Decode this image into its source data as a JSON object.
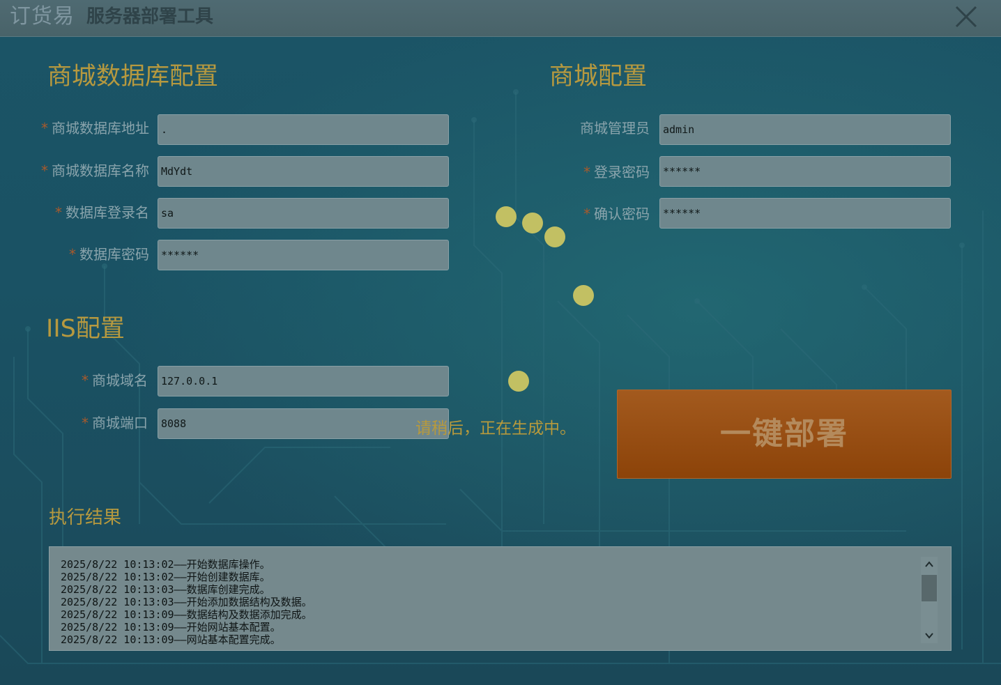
{
  "titlebar": {
    "logo": "订货易",
    "title": "服务器部署工具"
  },
  "db_config": {
    "title": "商城数据库配置",
    "fields": [
      {
        "label": "商城数据库地址",
        "value": ".",
        "required": true
      },
      {
        "label": "商城数据库名称",
        "value": "MdYdt",
        "required": true
      },
      {
        "label": "数据库登录名",
        "value": "sa",
        "required": true
      },
      {
        "label": "数据库密码",
        "value": "******",
        "required": true
      }
    ]
  },
  "iis_config": {
    "title": "IIS配置",
    "fields": [
      {
        "label": "商城域名",
        "value": "127.0.0.1",
        "required": true
      },
      {
        "label": "商城端口",
        "value": "8088",
        "required": true
      }
    ]
  },
  "mall_config": {
    "title": "商城配置",
    "fields": [
      {
        "label": "商城管理员",
        "value": "admin",
        "required": false
      },
      {
        "label": "登录密码",
        "value": "******",
        "required": true
      },
      {
        "label": "确认密码",
        "value": "******",
        "required": true
      }
    ]
  },
  "loading": {
    "text": "请稍后，正在生成中。"
  },
  "deploy_button": {
    "label": "一键部署"
  },
  "result": {
    "title": "执行结果",
    "log": [
      "2025/8/22 10:13:02——开始数据库操作。",
      "2025/8/22 10:13:02——开始创建数据库。",
      "2025/8/22 10:13:03——数据库创建完成。",
      "2025/8/22 10:13:03——开始添加数据结构及数据。",
      "2025/8/22 10:13:09——数据结构及数据添加完成。",
      "2025/8/22 10:13:09——开始网站基本配置。",
      "2025/8/22 10:13:09——网站基本配置完成。"
    ]
  },
  "colors": {
    "section_title": "#b6993f",
    "deploy_button": "#8c4309",
    "required_mark": "#a85a2c",
    "spinner_dot": "#c2c063"
  },
  "icons": {
    "close": "close-icon",
    "scroll_up": "chevron-up-icon",
    "scroll_down": "chevron-down-icon"
  }
}
